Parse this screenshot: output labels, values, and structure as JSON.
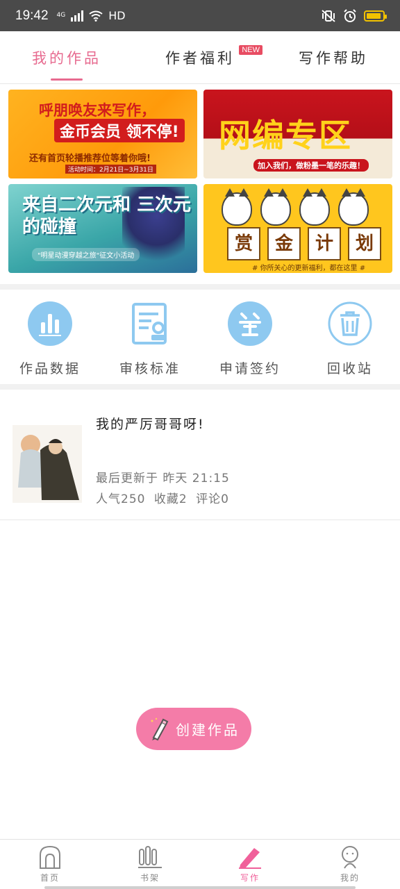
{
  "status_bar": {
    "time": "19:42",
    "network": "4G",
    "hd": "HD"
  },
  "tabs": [
    {
      "label": "我的作品",
      "active": true
    },
    {
      "label": "作者福利",
      "badge": "NEW"
    },
    {
      "label": "写作帮助"
    }
  ],
  "banners": [
    {
      "title": "呼朋唤友来写作，",
      "highlight": "金币会员 领不停!",
      "line": "还有首页轮播推荐位等着你哦!",
      "date": "活动时间：2月21日~3月31日"
    },
    {
      "title": "网编专区",
      "line": "加入我们，做粉墨一笔的乐趣！"
    },
    {
      "title": "来自二次元和 三次元的碰撞",
      "line": "\"明星动漫穿越之旅\"征文小活动"
    },
    {
      "chars": [
        "赏",
        "金",
        "计",
        "划"
      ],
      "line": "# 你所关心的更新福利，都在这里 #"
    }
  ],
  "functions": [
    {
      "label": "作品数据",
      "icon": "bar-chart-icon"
    },
    {
      "label": "审核标准",
      "icon": "audit-document-icon"
    },
    {
      "label": "申请签约",
      "icon": "sign-contract-icon"
    },
    {
      "label": "回收站",
      "icon": "trash-icon"
    }
  ],
  "work": {
    "title": "我的严厉哥哥呀!",
    "updated": "最后更新于 昨天 21:15",
    "popularity": "人气250",
    "favorites": "收藏2",
    "comments": "评论0"
  },
  "create_button": {
    "label": "创建作品"
  },
  "bottom_nav": [
    {
      "label": "首页",
      "icon": "home-icon"
    },
    {
      "label": "书架",
      "icon": "bookshelf-icon"
    },
    {
      "label": "写作",
      "icon": "write-pen-icon",
      "active": true
    },
    {
      "label": "我的",
      "icon": "profile-icon"
    }
  ],
  "colors": {
    "accent": "#f0609a",
    "tab_active": "#e76a8f",
    "icon_blue": "#8ec9f0",
    "create_button": "#f47ca8"
  }
}
